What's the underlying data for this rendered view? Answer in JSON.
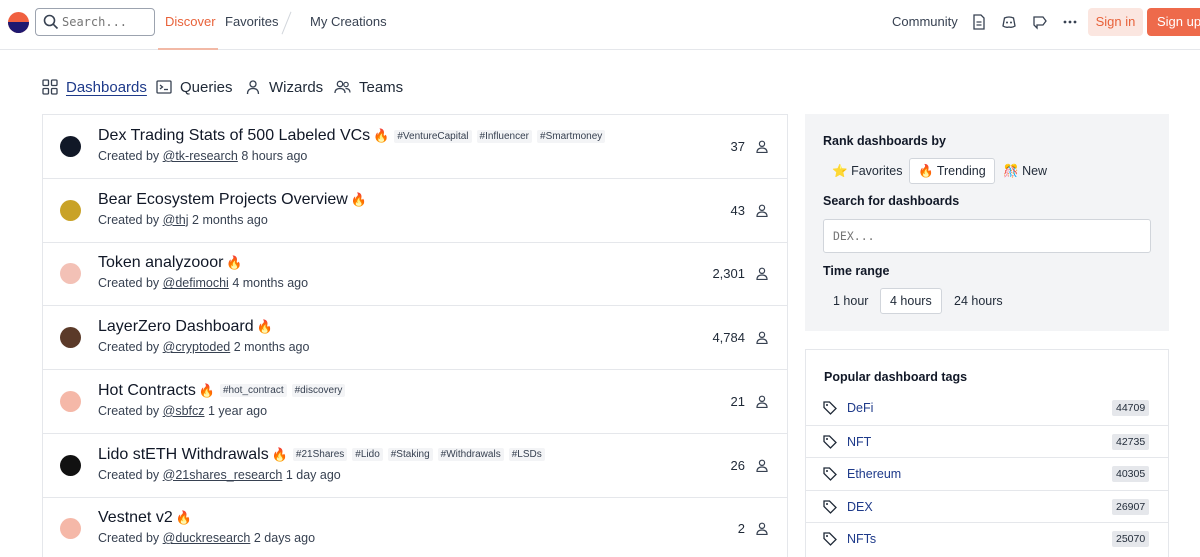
{
  "nav": {
    "search_placeholder": "Search...",
    "discover": "Discover",
    "favorites": "Favorites",
    "my_creations": "My Creations",
    "community": "Community",
    "sign_in": "Sign in",
    "sign_up": "Sign up"
  },
  "tabs": [
    "Dashboards",
    "Queries",
    "Wizards",
    "Teams"
  ],
  "dashboards": [
    {
      "title": "Dex Trading Stats of 500 Labeled VCs",
      "tags": [
        "#VentureCapital",
        "#Influencer",
        "#Smartmoney"
      ],
      "created_prefix": "Created by",
      "user": "@tk-research",
      "time": "8 hours ago",
      "count": "37",
      "avatar_color": "#111827"
    },
    {
      "title": "Bear Ecosystem Projects Overview",
      "tags": [],
      "created_prefix": "Created by",
      "user": "@thj",
      "time": "2 months ago",
      "count": "43",
      "avatar_color": "#c9a227"
    },
    {
      "title": "Token analyzooor",
      "tags": [],
      "created_prefix": "Created by",
      "user": "@defimochi",
      "time": "4 months ago",
      "count": "2,301",
      "avatar_color": "#f3c1b6"
    },
    {
      "title": "LayerZero Dashboard",
      "tags": [],
      "created_prefix": "Created by",
      "user": "@cryptoded",
      "time": "2 months ago",
      "count": "4,784",
      "avatar_color": "#5b3a29"
    },
    {
      "title": "Hot Contracts",
      "tags": [
        "#hot_contract",
        "#discovery"
      ],
      "created_prefix": "Created by",
      "user": "@sbfcz",
      "time": "1 year ago",
      "count": "21",
      "avatar_color": "#f5b8a8"
    },
    {
      "title": "Lido stETH Withdrawals",
      "tags": [
        "#21Shares",
        "#Lido",
        "#Staking",
        "#Withdrawals",
        "#LSDs"
      ],
      "created_prefix": "Created by",
      "user": "@21shares_research",
      "time": "1 day ago",
      "count": "26",
      "avatar_color": "#111111"
    },
    {
      "title": "Vestnet v2",
      "tags": [],
      "created_prefix": "Created by",
      "user": "@duckresearch",
      "time": "2 days ago",
      "count": "2",
      "avatar_color": "#f5b8a8"
    }
  ],
  "fire_icon": "🔥",
  "panel": {
    "rank_label": "Rank dashboards by",
    "rank_options": [
      {
        "icon": "⭐",
        "label": "Favorites"
      },
      {
        "icon": "🔥",
        "label": "Trending"
      },
      {
        "icon": "🎊",
        "label": "New"
      }
    ],
    "rank_selected": "Trending",
    "search_label": "Search for dashboards",
    "search_placeholder": "DEX...",
    "time_label": "Time range",
    "time_options": [
      "1 hour",
      "4 hours",
      "24 hours"
    ],
    "time_selected": "4 hours"
  },
  "popular_tags": {
    "label": "Popular dashboard tags",
    "items": [
      {
        "name": "DeFi",
        "count": "44709"
      },
      {
        "name": "NFT",
        "count": "42735"
      },
      {
        "name": "Ethereum",
        "count": "40305"
      },
      {
        "name": "DEX",
        "count": "26907"
      },
      {
        "name": "NFTs",
        "count": "25070"
      }
    ]
  },
  "colors": {
    "accent": "#e8623a",
    "link": "#1e3a8a",
    "panel_bg": "#f3f4f6"
  }
}
